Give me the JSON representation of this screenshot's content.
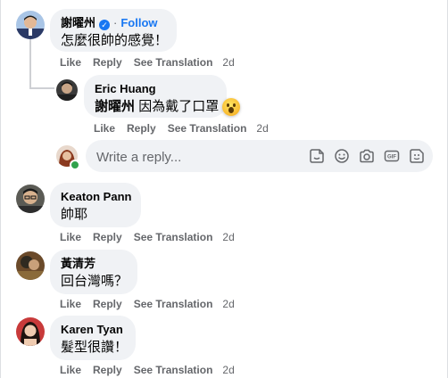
{
  "comments": [
    {
      "author": "謝曜州",
      "verified": true,
      "follow_label": "Follow",
      "follow_sep": "·",
      "text": "怎麼很帥的感覺！",
      "actions": {
        "like": "Like",
        "reply": "Reply",
        "translate": "See Translation",
        "time": "2d"
      }
    },
    {
      "author": "Eric Huang",
      "mention": "謝曜州",
      "text": "因為戴了口罩",
      "reaction_icon": "astonished-face-emoji",
      "actions": {
        "like": "Like",
        "reply": "Reply",
        "translate": "See Translation",
        "time": "2d"
      }
    },
    {
      "author": "Keaton Pann",
      "text": "帥耶",
      "actions": {
        "like": "Like",
        "reply": "Reply",
        "translate": "See Translation",
        "time": "2d"
      }
    },
    {
      "author": "黃清芳",
      "text": "回台灣嗎？",
      "actions": {
        "like": "Like",
        "reply": "Reply",
        "translate": "See Translation",
        "time": "2d"
      }
    },
    {
      "author": "Karen Tyan",
      "text": "髮型很讚！",
      "actions": {
        "like": "Like",
        "reply": "Reply",
        "translate": "See Translation",
        "time": "2d"
      }
    }
  ],
  "reply_box": {
    "placeholder": "Write a reply...",
    "tools": [
      "sticker-icon",
      "emoji-icon",
      "camera-icon",
      "gif-icon",
      "avatar-sticker-icon"
    ]
  },
  "colors": {
    "bubble": "#f0f2f5",
    "secondary_text": "#65676b",
    "link_blue": "#1877f2",
    "online_green": "#31a24c"
  }
}
